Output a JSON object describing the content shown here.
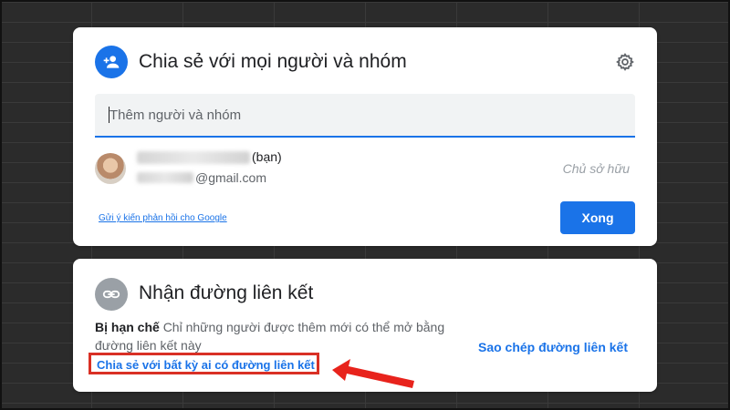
{
  "share_dialog": {
    "title": "Chia sẻ với mọi người và nhóm",
    "people_input": {
      "placeholder": "Thêm người và nhóm",
      "value": ""
    },
    "user": {
      "name_suffix": "(bạn)",
      "email_domain": "@gmail.com",
      "role": "Chủ sở hữu"
    },
    "feedback_link": "Gửi ý kiến phản hồi cho Google",
    "done_label": "Xong"
  },
  "link_section": {
    "title": "Nhận đường liên kết",
    "access_level": "Bị hạn chế",
    "access_description": "Chỉ những người được thêm mới có thể mở bằng đường liên kết này",
    "share_anyone_label": "Chia sẻ với bất kỳ ai có đường liên kết",
    "copy_link_label": "Sao chép đường liên kết"
  },
  "colors": {
    "accent": "#1a73e8",
    "annotation": "#d93025"
  },
  "icons": {
    "share": "person-add-icon",
    "settings": "gear-icon",
    "link": "link-icon",
    "annotation": "red-arrow-icon"
  }
}
